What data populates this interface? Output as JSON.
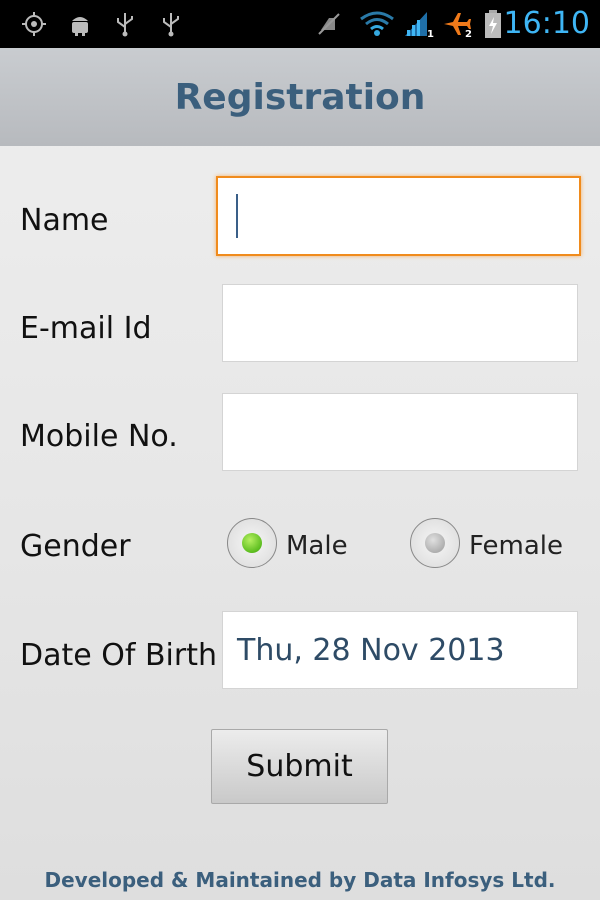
{
  "status_bar": {
    "time": "16:10",
    "icons": [
      "gps-icon",
      "android-icon",
      "usb-icon",
      "usb-icon",
      "muted-icon",
      "wifi-icon",
      "signal-1-icon",
      "airplane-2-icon",
      "battery-charging-icon"
    ],
    "sim1_label": "1",
    "sim2_label": "2",
    "accent_color": "#3fb6f5"
  },
  "header": {
    "title": "Registration"
  },
  "form": {
    "name_label": "Name",
    "name_value": "",
    "email_label": "E-mail Id",
    "email_value": "",
    "mobile_label": "Mobile No.",
    "mobile_value": "",
    "gender_label": "Gender",
    "gender_options": [
      {
        "label": "Male",
        "selected": true
      },
      {
        "label": "Female",
        "selected": false
      }
    ],
    "dob_label": "Date Of Birth",
    "dob_value": "Thu, 28 Nov 2013",
    "submit_label": "Submit"
  },
  "footer": {
    "text": "Developed & Maintained by Data Infosys Ltd."
  },
  "colors": {
    "title": "#3b5f7d",
    "focus_border": "#f08b1c",
    "radio_selected": "#5cbd1f"
  }
}
